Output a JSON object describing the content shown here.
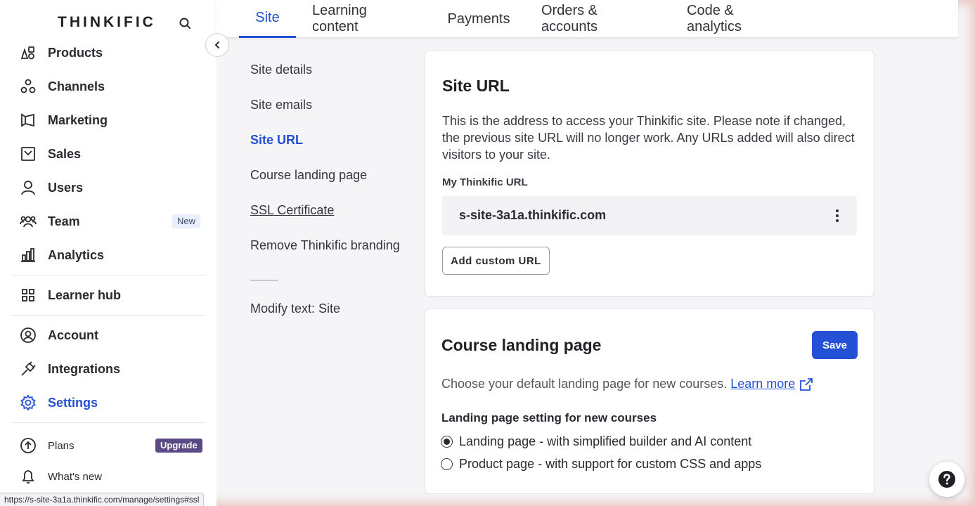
{
  "sidebar": {
    "logo": "THINKIFIC",
    "items": [
      {
        "label": "Products",
        "icon": "products-icon"
      },
      {
        "label": "Channels",
        "icon": "channels-icon"
      },
      {
        "label": "Marketing",
        "icon": "megaphone-icon"
      },
      {
        "label": "Sales",
        "icon": "inbox-icon"
      },
      {
        "label": "Users",
        "icon": "user-icon"
      },
      {
        "label": "Team",
        "icon": "team-icon",
        "badge": "New"
      },
      {
        "label": "Analytics",
        "icon": "bar-chart-icon"
      },
      {
        "label": "Learner hub",
        "icon": "grid-icon"
      },
      {
        "label": "Account",
        "icon": "account-icon"
      },
      {
        "label": "Integrations",
        "icon": "plug-icon"
      },
      {
        "label": "Settings",
        "icon": "gear-icon",
        "active": true
      },
      {
        "label": "Plans",
        "icon": "arrow-up-circle-icon",
        "badge": "Upgrade"
      },
      {
        "label": "What's new",
        "icon": "bell-icon"
      }
    ]
  },
  "tabs": [
    {
      "label": "Site",
      "active": true
    },
    {
      "label": "Learning content"
    },
    {
      "label": "Payments"
    },
    {
      "label": "Orders & accounts"
    },
    {
      "label": "Code & analytics"
    }
  ],
  "subnav": [
    {
      "label": "Site details"
    },
    {
      "label": "Site emails"
    },
    {
      "label": "Site URL",
      "active": true
    },
    {
      "label": "Course landing page"
    },
    {
      "label": "SSL Certificate"
    },
    {
      "label": "Remove Thinkific branding"
    },
    {
      "label": "Modify text: Site"
    }
  ],
  "site_url_card": {
    "title": "Site URL",
    "description": "This is the address to access your Thinkific site. Please note if changed, the previous site URL will no longer work. Any URLs added will also direct visitors to your site.",
    "field_label": "My Thinkific URL",
    "url": "s-site-3a1a.thinkific.com",
    "add_button": "Add custom URL"
  },
  "landing_card": {
    "title": "Course landing page",
    "save_button": "Save",
    "description": "Choose your default landing page for new courses.",
    "learn_more": "Learn more",
    "setting_label": "Landing page setting for new courses",
    "options": [
      {
        "label": "Landing page - with simplified builder and AI content",
        "checked": true
      },
      {
        "label": "Product page - with support for custom CSS and apps",
        "checked": false
      }
    ]
  },
  "status_bar_url": "https://s-site-3a1a.thinkific.com/manage/settings#ssl",
  "colors": {
    "accent": "#2350d4",
    "upgrade_badge": "#5b4a86"
  }
}
